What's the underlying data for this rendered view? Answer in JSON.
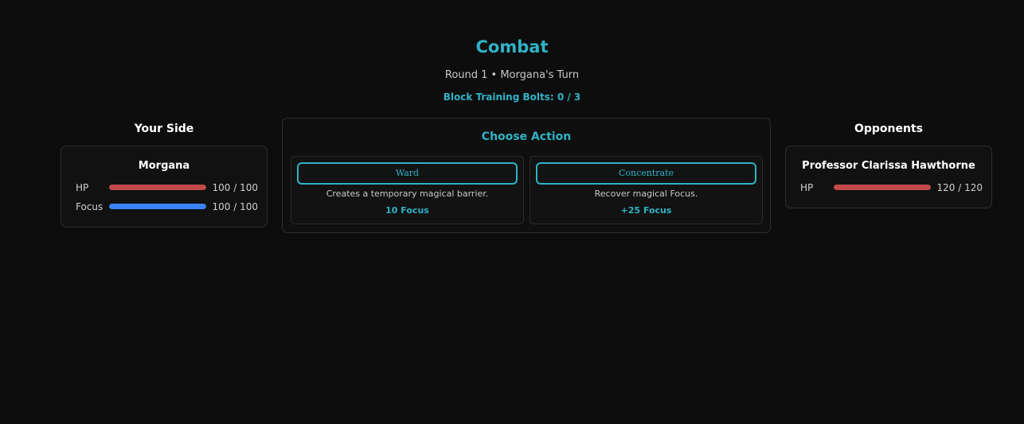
{
  "header": {
    "title": "Combat",
    "round_status": "Round 1 • Morgana's Turn",
    "bolts_status": "Block Training Bolts: 0 / 3"
  },
  "your_side": {
    "heading": "Your Side",
    "combatant": {
      "name": "Morgana",
      "stats": [
        {
          "label": "HP",
          "value": "100 / 100",
          "current": 100,
          "max": 100,
          "color": "#c24a4a"
        },
        {
          "label": "Focus",
          "value": "100 / 100",
          "current": 100,
          "max": 100,
          "color": "#3b82f6"
        }
      ]
    }
  },
  "action_panel": {
    "heading": "Choose Action",
    "actions": [
      {
        "label": "Ward",
        "description": "Creates a temporary magical barrier.",
        "cost": "10 Focus"
      },
      {
        "label": "Concentrate",
        "description": "Recover magical Focus.",
        "cost": "+25 Focus"
      }
    ]
  },
  "opponents": {
    "heading": "Opponents",
    "combatant": {
      "name": "Professor Clarissa Hawthorne",
      "stats": [
        {
          "label": "HP",
          "value": "120 / 120",
          "current": 120,
          "max": 120,
          "color": "#c24a4a"
        }
      ]
    }
  },
  "colors": {
    "accent": "#2fb3c6",
    "hp": "#c24a4a",
    "focus": "#3b82f6",
    "background": "#0d0d0d"
  }
}
